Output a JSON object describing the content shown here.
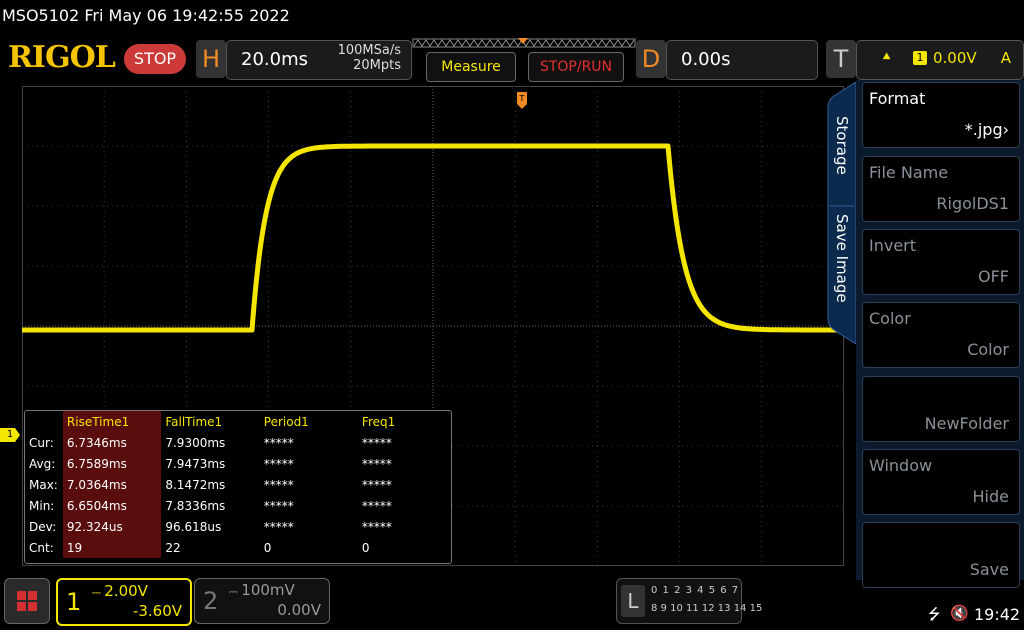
{
  "status_line": "MSO5102  Fri May 06 19:42:55 2022",
  "brand": {
    "logo": "RIGOL",
    "run_state": "STOP"
  },
  "horizontal": {
    "letter": "H",
    "timebase": "20.0ms",
    "sample_rate": "100MSa/s",
    "memory_depth": "20Mpts"
  },
  "toolbar": {
    "measure_label": "Measure",
    "stop_run_label": "STOP/RUN"
  },
  "delay": {
    "letter": "D",
    "value": "0.00s"
  },
  "trigger": {
    "letter": "T",
    "source": "1",
    "level": "0.00V",
    "mode": "A"
  },
  "channel_marker": "1",
  "measurements": {
    "row_labels": [
      "Cur:",
      "Avg:",
      "Max:",
      "Min:",
      "Dev:",
      "Cnt:"
    ],
    "columns": [
      {
        "name": "RiseTime1",
        "values": [
          "6.7346ms",
          "6.7589ms",
          "7.0364ms",
          "6.6504ms",
          "92.324us",
          "19"
        ]
      },
      {
        "name": "FallTime1",
        "values": [
          "7.9300ms",
          "7.9473ms",
          "8.1472ms",
          "7.8336ms",
          "96.618us",
          "22"
        ]
      },
      {
        "name": "Period1",
        "values": [
          "*****",
          "*****",
          "*****",
          "*****",
          "*****",
          "0"
        ]
      },
      {
        "name": "Freq1",
        "values": [
          "*****",
          "*****",
          "*****",
          "*****",
          "*****",
          "0"
        ]
      }
    ]
  },
  "side_menu": {
    "tabs": [
      "Storage",
      "Save Image"
    ],
    "items": [
      {
        "title": "Format",
        "value": "*.jpg",
        "enabled": true
      },
      {
        "title": "File Name",
        "value": "RigolDS1",
        "enabled": false
      },
      {
        "title": "Invert",
        "value": "OFF",
        "enabled": false
      },
      {
        "title": "Color",
        "value": "Color",
        "enabled": false
      },
      {
        "title": "",
        "value": "NewFolder",
        "enabled": false
      },
      {
        "title": "Window",
        "value": "Hide",
        "enabled": false
      },
      {
        "title": "",
        "value": "Save",
        "enabled": false
      }
    ]
  },
  "channels": {
    "ch1": {
      "num": "1",
      "scale": "2.00V",
      "offset": "-3.60V"
    },
    "ch2": {
      "num": "2",
      "scale": "100mV",
      "offset": "0.00V"
    }
  },
  "logic": {
    "letter": "L",
    "row1": "0 1 2 3  4 5 6 7",
    "row2": "8 9 10 11 12 13 14 15"
  },
  "clock": "19:42",
  "colors": {
    "ch1": "#f5e600",
    "accent_orange": "#f08a24",
    "stop_red": "#cc3a3a",
    "menu_bg": "#0b1a2c"
  }
}
